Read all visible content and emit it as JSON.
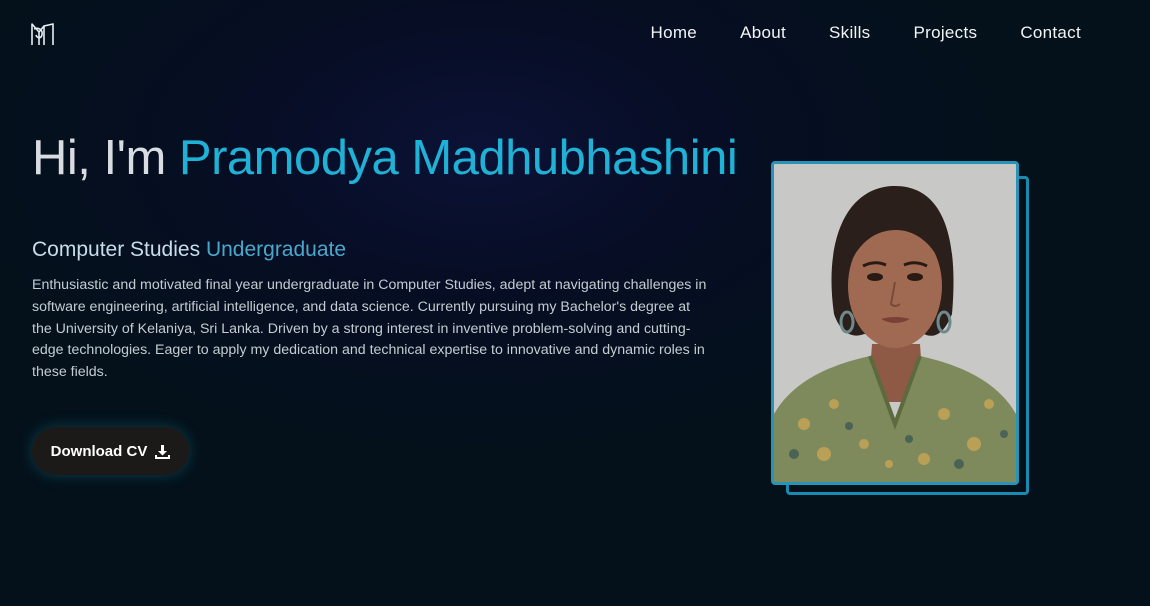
{
  "nav": {
    "items": [
      {
        "label": "Home"
      },
      {
        "label": "About"
      },
      {
        "label": "Skills"
      },
      {
        "label": "Projects"
      },
      {
        "label": "Contact"
      }
    ]
  },
  "hero": {
    "greeting": "Hi, I'm",
    "name": "Pramodya Madhubhashini",
    "subtitle_part1": "Computer Studies",
    "subtitle_part2": "Undergraduate",
    "bio": "Enthusiastic and motivated final year undergraduate in Computer Studies, adept at navigating challenges in software engineering, artificial intelligence, and data science. Currently pursuing my Bachelor's degree at the University of Kelaniya, Sri Lanka. Driven by a strong interest in inventive problem-solving and cutting-edge technologies. Eager to apply my dedication and technical expertise to innovative and dynamic roles in these fields.",
    "cv_button_label": "Download CV",
    "cv_icon": "download-icon",
    "photo_icon": "profile-photo"
  },
  "colors": {
    "accent": "#1fb2d6",
    "frame": "#2793b6",
    "background": "#03121c",
    "button_bg": "#1c1a19"
  }
}
